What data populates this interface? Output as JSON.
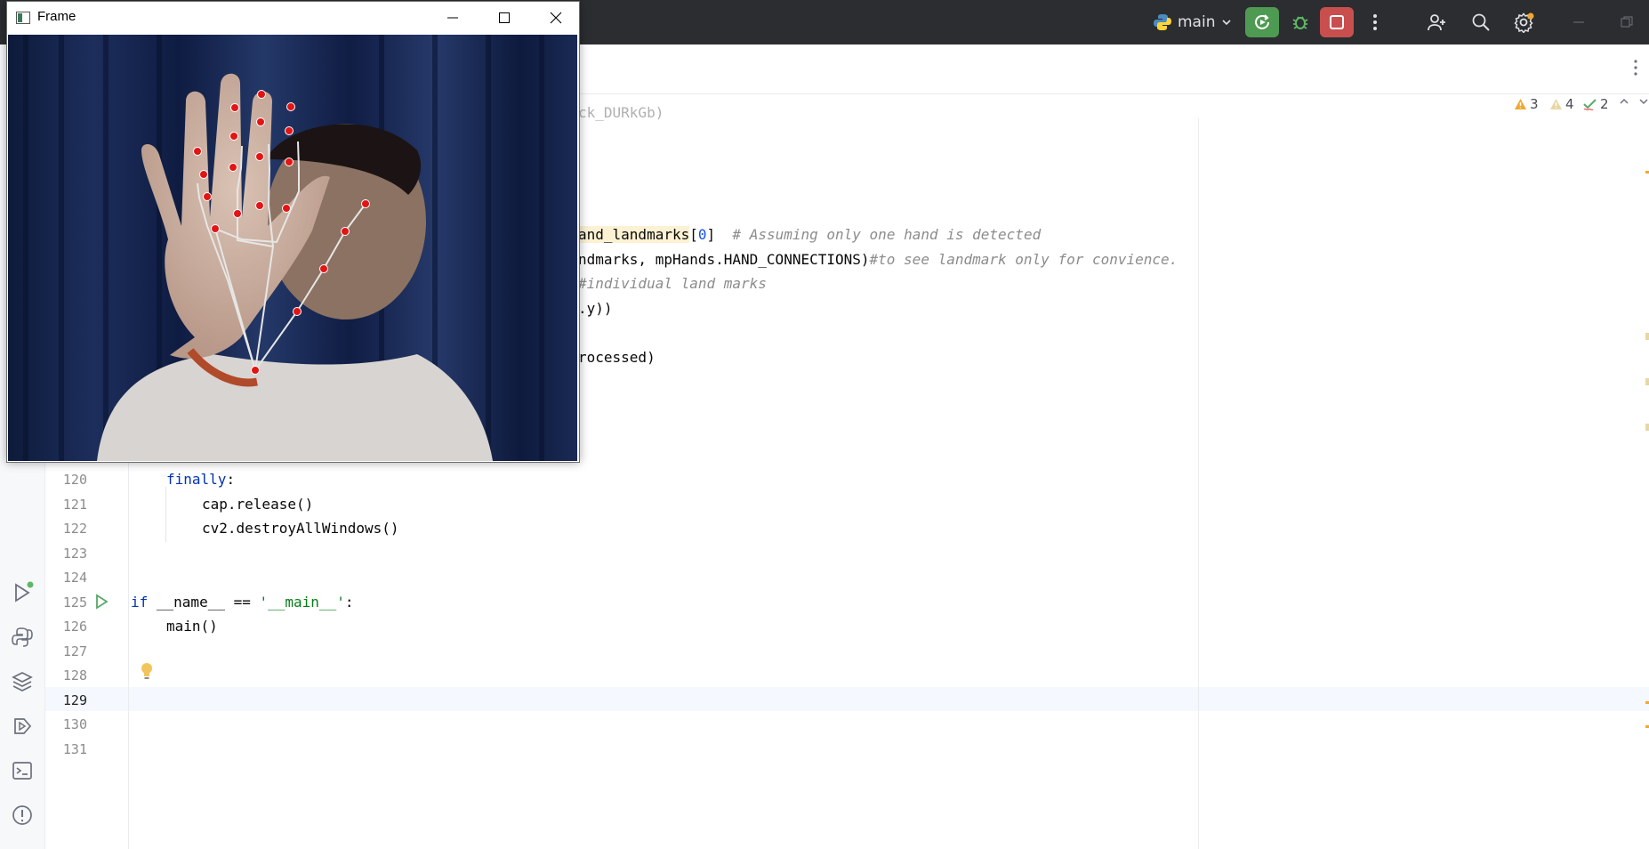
{
  "frame_window": {
    "title": "Frame"
  },
  "toolbar": {
    "branch": "main",
    "notification_color": "#f0a832"
  },
  "inspections": {
    "warnings": "3",
    "weak_warnings": "4",
    "typos": "2"
  },
  "code_lines": {
    "partial_a": "and_landmarks",
    "partial_a_idx": "0",
    "partial_a_close": "]",
    "partial_a_comment": "# Assuming only one hand is detected",
    "partial_b": "ndmarks, mpHands.HAND_CONNECTIONS)",
    "partial_b_comment": "#to see landmark only for convience.",
    "partial_c_comment": "#individual land marks",
    "partial_d": ".y))",
    "partial_e": "rocessed)",
    "top_clip": "ck_DURkGb)",
    "l120_kw": "finally",
    "l120_colon": ":",
    "l121": "cap.release()",
    "l122": "cv2.destroyAllWindows()",
    "l125_kw": "if",
    "l125_mid": " __name__ == ",
    "l125_str": "'__main__'",
    "l125_end": ":",
    "l126": "main()"
  },
  "line_numbers": [
    "120",
    "121",
    "122",
    "123",
    "124",
    "125",
    "126",
    "127",
    "128",
    "129",
    "130",
    "131"
  ],
  "hand_landmarks_count": "21"
}
